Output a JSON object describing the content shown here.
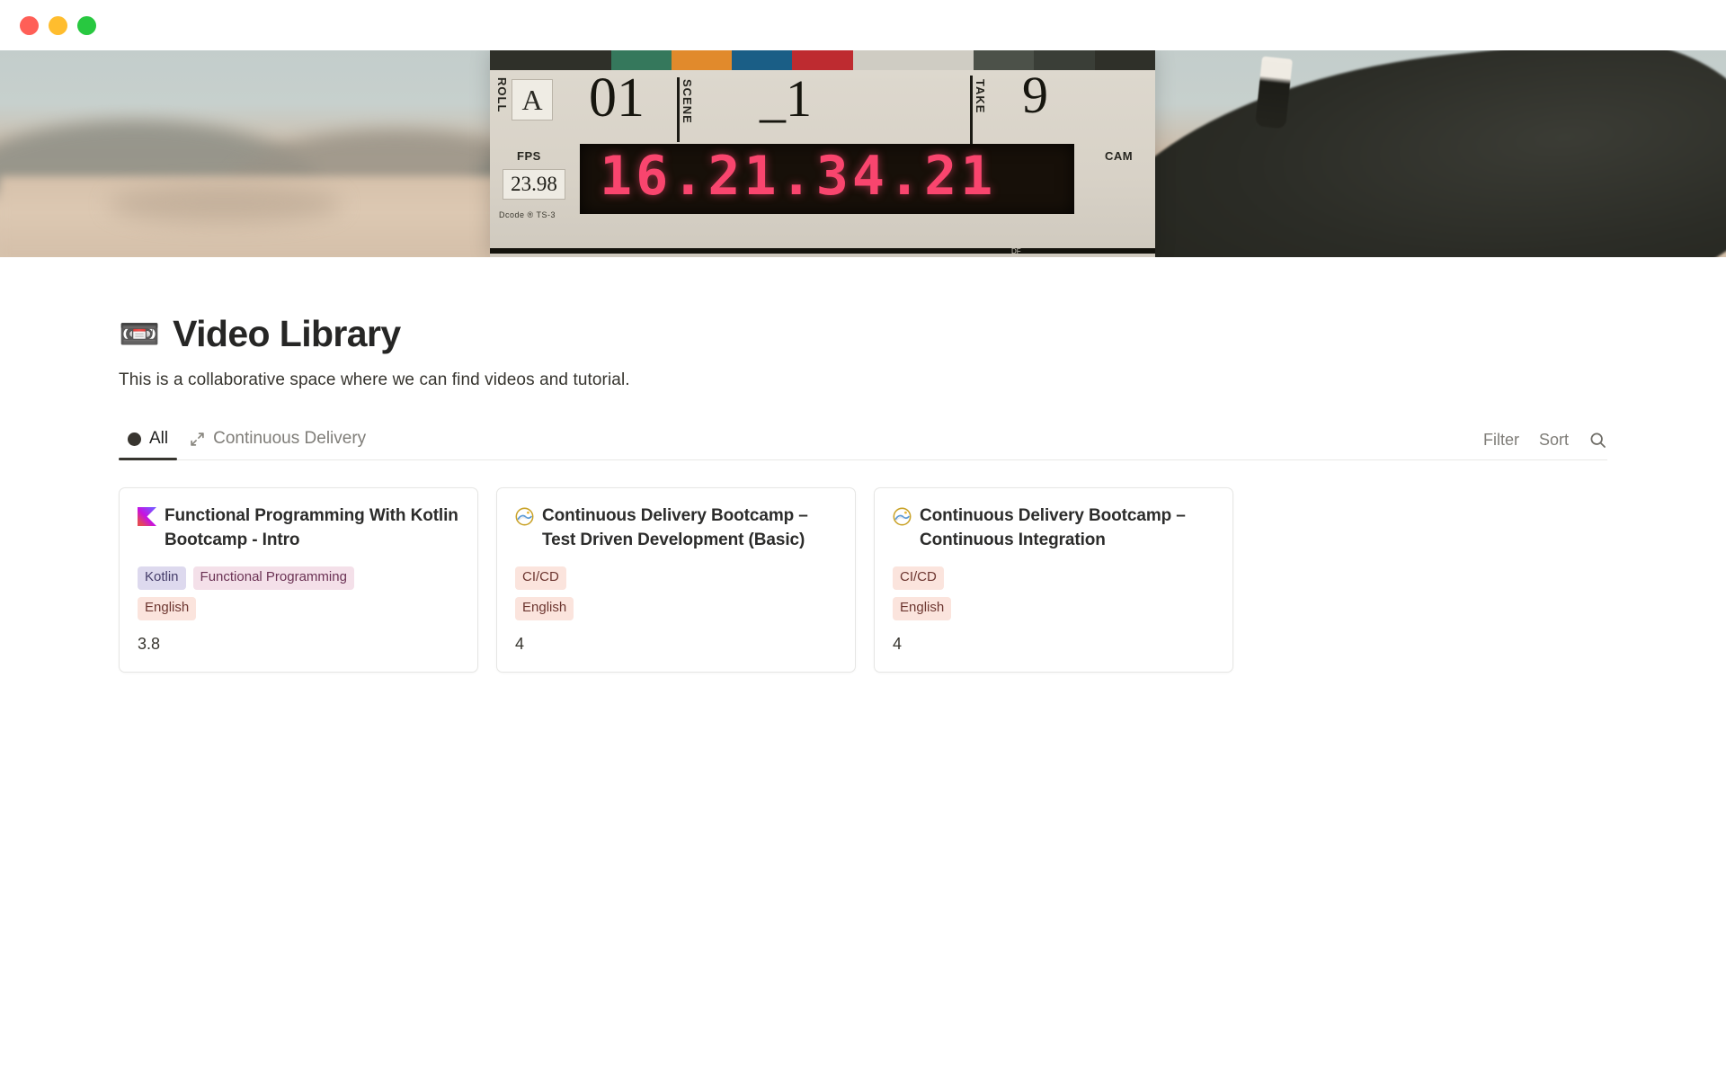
{
  "window": {
    "controls": [
      {
        "name": "close",
        "color": "#FF5F57"
      },
      {
        "name": "minimize",
        "color": "#FFBD2E"
      },
      {
        "name": "maximize",
        "color": "#28C840"
      }
    ]
  },
  "banner": {
    "description": "film clapperboard slate held in desert landscape",
    "slate": {
      "roll_label": "ROLL",
      "roll_value": "A",
      "roll_number": "01",
      "scene_label": "SCENE",
      "scene_value": "_1",
      "take_label": "TAKE",
      "take_value": "9",
      "fps_label": "FPS",
      "fps_value": "23.98",
      "brand": "Dcode ®   TS-3",
      "cam_label": "CAM",
      "timecode": "16.21.34.21",
      "df_label": "DF",
      "clapper_colors": [
        "#2f3029",
        "#2f3029",
        "#35785c",
        "#e18a2c",
        "#1a5e86",
        "#be2b30",
        "#cfccc3",
        "#cfccc3",
        "#4c5149",
        "#3a3e37",
        "#2f3029"
      ]
    }
  },
  "header": {
    "emoji": "📼",
    "emoji_name": "videocassette",
    "title": "Video Library",
    "subtitle": "This is a collaborative space where we can find videos and tutorial."
  },
  "tabbar": {
    "tabs": [
      {
        "label": "All",
        "icon": "filled-circle-icon",
        "active": true
      },
      {
        "label": "Continuous Delivery",
        "icon": "expand-arrows-icon",
        "active": false
      }
    ],
    "actions": {
      "filter_label": "Filter",
      "sort_label": "Sort",
      "search_icon": "search-icon"
    }
  },
  "cards": [
    {
      "icon": "kotlin-logo-icon",
      "title": "Functional Programming With Kotlin Bootcamp - Intro",
      "tags": [
        {
          "label": "Kotlin",
          "style": "t-purple"
        },
        {
          "label": "Functional Programming",
          "style": "t-pink"
        },
        {
          "label": "English",
          "style": "t-peach"
        }
      ],
      "number": "3.8"
    },
    {
      "icon": "wave-circle-logo-icon",
      "title": "Continuous Delivery Bootcamp – Test Driven Development (Basic)",
      "tags": [
        {
          "label": "CI/CD",
          "style": "t-peach"
        },
        {
          "label": "English",
          "style": "t-peach"
        }
      ],
      "number": "4"
    },
    {
      "icon": "wave-circle-logo-icon",
      "title": "Continuous Delivery Bootcamp – Continuous Integration",
      "tags": [
        {
          "label": "CI/CD",
          "style": "t-peach"
        },
        {
          "label": "English",
          "style": "t-peach"
        }
      ],
      "number": "4"
    }
  ],
  "colors": {
    "accent_tab_underline": "#37352f",
    "text_primary": "#37352f",
    "text_muted": "#7f7d78",
    "card_border": "#e6e6e4"
  }
}
